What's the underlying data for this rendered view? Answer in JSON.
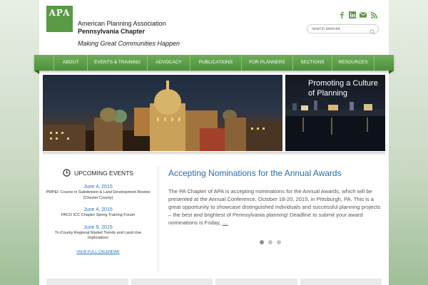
{
  "brand": {
    "logo_text": "APA",
    "org_name": "American Planning Association",
    "chapter": "Pennsylvania Chapter",
    "tagline": "Making Great Communities Happen"
  },
  "social": [
    "facebook-icon",
    "linkedin-icon",
    "email-icon",
    "rss-icon"
  ],
  "search": {
    "placeholder": "search website"
  },
  "nav": {
    "items": [
      {
        "label": "About"
      },
      {
        "label": "Events & Training"
      },
      {
        "label": "Advocacy"
      },
      {
        "label": "Publications"
      },
      {
        "label": "For Planners"
      },
      {
        "label": "Sections"
      },
      {
        "label": "Resources"
      }
    ]
  },
  "hero": {
    "side_caption": "Promoting a Culture of Planning"
  },
  "events": {
    "heading": "Upcoming Events",
    "items": [
      {
        "date": "June 4, 2015",
        "title": "PMPEI: Course in Subdivision & Land Development Review (Chester County)"
      },
      {
        "date": "June 4, 2015",
        "title": "PACO ICC Chapter Spring Training Forum"
      },
      {
        "date": "June 9, 2015",
        "title": "Tri-County Regional Market Trends and Land-Use Implications"
      }
    ],
    "calendar_link": "View Full Calendar"
  },
  "article": {
    "title": "Accepting Nominations for the Annual Awards",
    "body": "The PA Chapter of APA is accepting nominations for the Annual Awards, which will be presented at the Annual Conference, October 18-20, 2015, in Pittsburgh, PA.  This is a great opportunity to showcase distinguished individuals and successful planning projects – the best and brightest of Pennsylvania planning! Deadline to submit your award nominations is Friday,",
    "more": "...."
  },
  "slider": {
    "active_index": 0,
    "count": 3
  },
  "colors": {
    "brand_green": "#5a9a46",
    "link_blue": "#2a74b8"
  }
}
